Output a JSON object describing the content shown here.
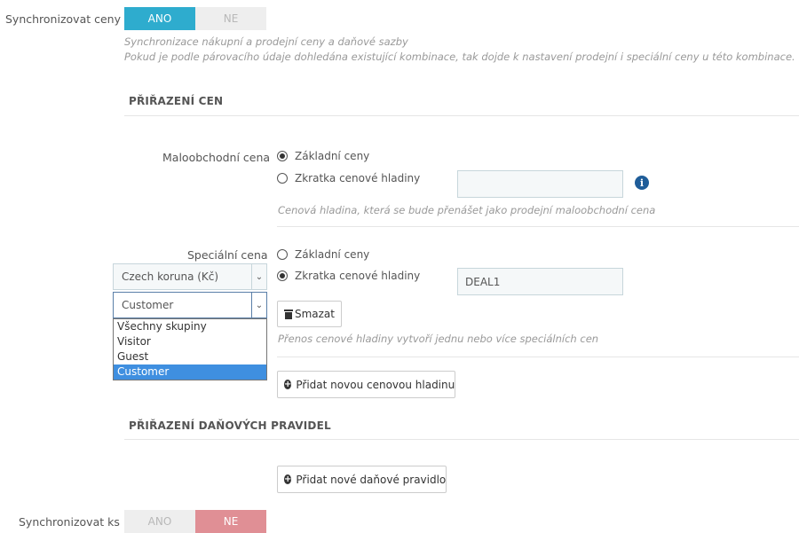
{
  "sync_prices": {
    "label": "Synchronizovat ceny",
    "yes": "ANO",
    "no": "NE",
    "help_line1": "Synchronizace nákupní a prodejní ceny a daňové sazby",
    "help_line2": "Pokud je podle párovacího údaje dohledána existující kombinace, tak dojde k nastavení prodejní i speciální ceny u této kombinace."
  },
  "price_assignment": {
    "section_title": "PŘIŘAZENÍ CEN",
    "retail": {
      "label": "Maloobchodní cena",
      "option_base": "Základní ceny",
      "option_shortcut": "Zkratka cenové hladiny",
      "shortcut_value": "",
      "help": "Cenová hladina, která se bude přenášet jako prodejní maloobchodní cena"
    },
    "special": {
      "label": "Speciální cena",
      "option_base": "Základní ceny",
      "option_shortcut": "Zkratka cenové hladiny",
      "shortcut_value": "DEAL1",
      "currency_select": "Czech koruna (Kč)",
      "group_select": "Customer",
      "group_options": [
        "Všechny skupiny",
        "Visitor",
        "Guest",
        "Customer"
      ],
      "delete_button": "Smazat",
      "help": "Přenos cenové hladiny vytvoří jednu nebo více speciálních cen"
    },
    "add_level_button": "Přidat novou cenovou hladinu"
  },
  "tax_assignment": {
    "section_title": "PŘIŘAZENÍ DAŇOVÝCH PRAVIDEL",
    "add_rule_button": "Přidat nové daňové pravidlo"
  },
  "sync_stock": {
    "label": "Synchronizovat ks",
    "yes": "ANO",
    "no": "NE"
  },
  "colors": {
    "toggle_yes_active": "#2eacce",
    "toggle_no_active": "#e08f95",
    "info_icon": "#1f5d99",
    "dropdown_selected": "#3f8fe0"
  },
  "icons": {
    "info": "info-icon",
    "trash": "trash-icon",
    "plus": "plus-circle-icon",
    "select_arrow": "chevron-down-icon"
  }
}
